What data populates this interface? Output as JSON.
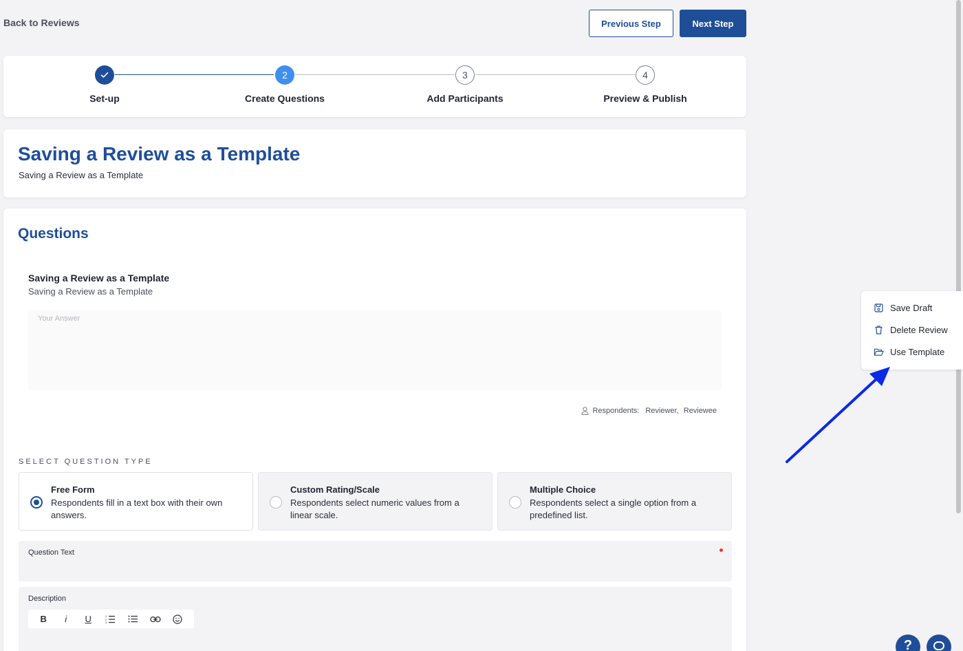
{
  "header": {
    "back_label": "Back to Reviews",
    "previous_label": "Previous Step",
    "next_label": "Next Step"
  },
  "stepper": {
    "steps": [
      {
        "number": "1",
        "label": "Set-up",
        "state": "done"
      },
      {
        "number": "2",
        "label": "Create Questions",
        "state": "active"
      },
      {
        "number": "3",
        "label": "Add Participants",
        "state": "todo"
      },
      {
        "number": "4",
        "label": "Preview & Publish",
        "state": "todo"
      }
    ]
  },
  "review": {
    "title": "Saving a Review as a Template",
    "subtitle": "Saving a Review as a Template"
  },
  "questions": {
    "heading": "Questions",
    "question_title": "Saving a Review as a Template",
    "question_desc": "Saving a Review as a Template",
    "answer_placeholder": "Your Answer",
    "respondents_label": "Respondents:",
    "respondents": [
      "Reviewer,",
      "Reviewee"
    ]
  },
  "question_type": {
    "label": "SELECT QUESTION TYPE",
    "options": [
      {
        "name": "Free Form",
        "desc": "Respondents fill in a text box with their own answers.",
        "selected": true
      },
      {
        "name": "Custom Rating/Scale",
        "desc": "Respondents select numeric values from a linear scale.",
        "selected": false
      },
      {
        "name": "Multiple Choice",
        "desc": "Respondents select a single option from a predefined list.",
        "selected": false
      }
    ]
  },
  "fields": {
    "question_text_label": "Question Text",
    "description_label": "Description"
  },
  "toolbar": {
    "bold": "B",
    "italic": "i",
    "underline": "U"
  },
  "side_menu": {
    "save_draft": "Save Draft",
    "delete_review": "Delete Review",
    "use_template": "Use Template"
  },
  "floating": {
    "help": "?"
  },
  "colors": {
    "brand": "#1f4e99",
    "active_step": "#3f8ef0",
    "annotation_arrow": "#0a2ae6",
    "required": "#e53935"
  }
}
